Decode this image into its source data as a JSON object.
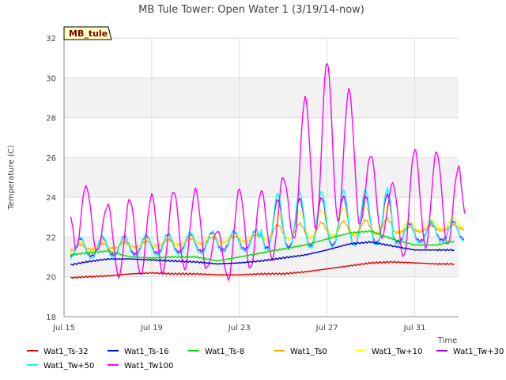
{
  "chart_data": {
    "type": "line",
    "title": "MB Tule Tower: Open Water 1 (3/19/14-now)",
    "annotation": "MB_tule",
    "xlabel": "Time",
    "ylabel": "Temperature (C)",
    "x_range_days": [
      15,
      33
    ],
    "x_ticks": [
      {
        "day": 15,
        "label": "Jul 15"
      },
      {
        "day": 19,
        "label": "Jul 19"
      },
      {
        "day": 23,
        "label": "Jul 23"
      },
      {
        "day": 27,
        "label": "Jul 27"
      },
      {
        "day": 31,
        "label": "Jul 31"
      }
    ],
    "ylim": [
      18,
      32
    ],
    "y_ticks": [
      18,
      20,
      22,
      24,
      26,
      28,
      30,
      32
    ],
    "grid": true,
    "legend_position": "bottom",
    "series": [
      {
        "name": "Wat1_Ts-32",
        "color": "#dd0000",
        "points": [
          [
            15.3,
            19.95
          ],
          [
            16,
            20.0
          ],
          [
            17,
            20.05
          ],
          [
            18,
            20.15
          ],
          [
            19,
            20.2
          ],
          [
            20,
            20.15
          ],
          [
            21,
            20.15
          ],
          [
            22,
            20.1
          ],
          [
            23,
            20.1
          ],
          [
            24,
            20.15
          ],
          [
            25,
            20.15
          ],
          [
            26,
            20.25
          ],
          [
            27,
            20.4
          ],
          [
            28,
            20.55
          ],
          [
            29,
            20.7
          ],
          [
            30,
            20.75
          ],
          [
            31,
            20.7
          ],
          [
            32,
            20.65
          ],
          [
            32.8,
            20.65
          ]
        ]
      },
      {
        "name": "Wat1_Ts-16",
        "color": "#0000cc",
        "points": [
          [
            15.3,
            20.6
          ],
          [
            16,
            20.75
          ],
          [
            17,
            20.9
          ],
          [
            18,
            20.9
          ],
          [
            19,
            20.85
          ],
          [
            20,
            20.8
          ],
          [
            21,
            20.75
          ],
          [
            22,
            20.65
          ],
          [
            23,
            20.7
          ],
          [
            24,
            20.8
          ],
          [
            25,
            20.95
          ],
          [
            26,
            21.1
          ],
          [
            27,
            21.35
          ],
          [
            28,
            21.65
          ],
          [
            29,
            21.75
          ],
          [
            30,
            21.55
          ],
          [
            31,
            21.35
          ],
          [
            32,
            21.35
          ],
          [
            32.8,
            21.35
          ]
        ]
      },
      {
        "name": "Wat1_Ts-8",
        "color": "#00dd00",
        "points": [
          [
            15.3,
            21.1
          ],
          [
            16,
            21.2
          ],
          [
            17,
            21.3
          ],
          [
            18,
            21.0
          ],
          [
            19,
            20.95
          ],
          [
            20,
            21.0
          ],
          [
            21,
            21.0
          ],
          [
            22,
            20.8
          ],
          [
            23,
            21.0
          ],
          [
            24,
            21.2
          ],
          [
            25,
            21.4
          ],
          [
            26,
            21.6
          ],
          [
            27,
            21.9
          ],
          [
            28,
            22.2
          ],
          [
            29,
            22.3
          ],
          [
            30,
            21.9
          ],
          [
            31,
            21.6
          ],
          [
            32,
            21.6
          ],
          [
            32.8,
            21.8
          ]
        ]
      },
      {
        "name": "Wat1_Ts0",
        "color": "#ffaa00",
        "base": 21.3,
        "amp": 0.7,
        "drift": 0.06
      },
      {
        "name": "Wat1_Tw+10",
        "color": "#ffff00",
        "base": 21.2,
        "amp": 1.3,
        "drift": 0.07
      },
      {
        "name": "Wat1_Tw+30",
        "color": "#9900ff",
        "base": 21.0,
        "amp": 2.3,
        "drift": 0.05
      },
      {
        "name": "Wat1_Tw+50",
        "color": "#00ffff",
        "base": 20.9,
        "amp": 2.7,
        "drift": 0.05
      },
      {
        "name": "Wat1_Tw100",
        "color": "#ff00ff",
        "base": 20.8,
        "amp": 3.0,
        "drift": 0.05,
        "peaks": [
          [
            15.3,
            23.0
          ],
          [
            15.55,
            21.4
          ],
          [
            16,
            24.6
          ],
          [
            16.5,
            21.3
          ],
          [
            17,
            23.6
          ],
          [
            17.5,
            20.0
          ],
          [
            18,
            23.9
          ],
          [
            18.5,
            20.1
          ],
          [
            19,
            24.1
          ],
          [
            19.5,
            20.2
          ],
          [
            20,
            24.3
          ],
          [
            20.5,
            20.4
          ],
          [
            21,
            24.4
          ],
          [
            21.5,
            20.4
          ],
          [
            22,
            22.3
          ],
          [
            22.5,
            19.9
          ],
          [
            23,
            24.4
          ],
          [
            23.5,
            20.4
          ],
          [
            24,
            24.3
          ],
          [
            24.5,
            20.9
          ],
          [
            25,
            25.0
          ],
          [
            25.5,
            21.9
          ],
          [
            26,
            29.0
          ],
          [
            26.5,
            22.4
          ],
          [
            27,
            30.8
          ],
          [
            27.5,
            22.8
          ],
          [
            28,
            29.4
          ],
          [
            28.5,
            22.6
          ],
          [
            29,
            26.1
          ],
          [
            29.5,
            22.0
          ],
          [
            30,
            24.7
          ],
          [
            30.5,
            21.0
          ],
          [
            31,
            26.4
          ],
          [
            31.5,
            21.5
          ],
          [
            32,
            26.3
          ],
          [
            32.5,
            21.6
          ],
          [
            33,
            25.5
          ],
          [
            33.3,
            23.2
          ]
        ]
      }
    ]
  }
}
